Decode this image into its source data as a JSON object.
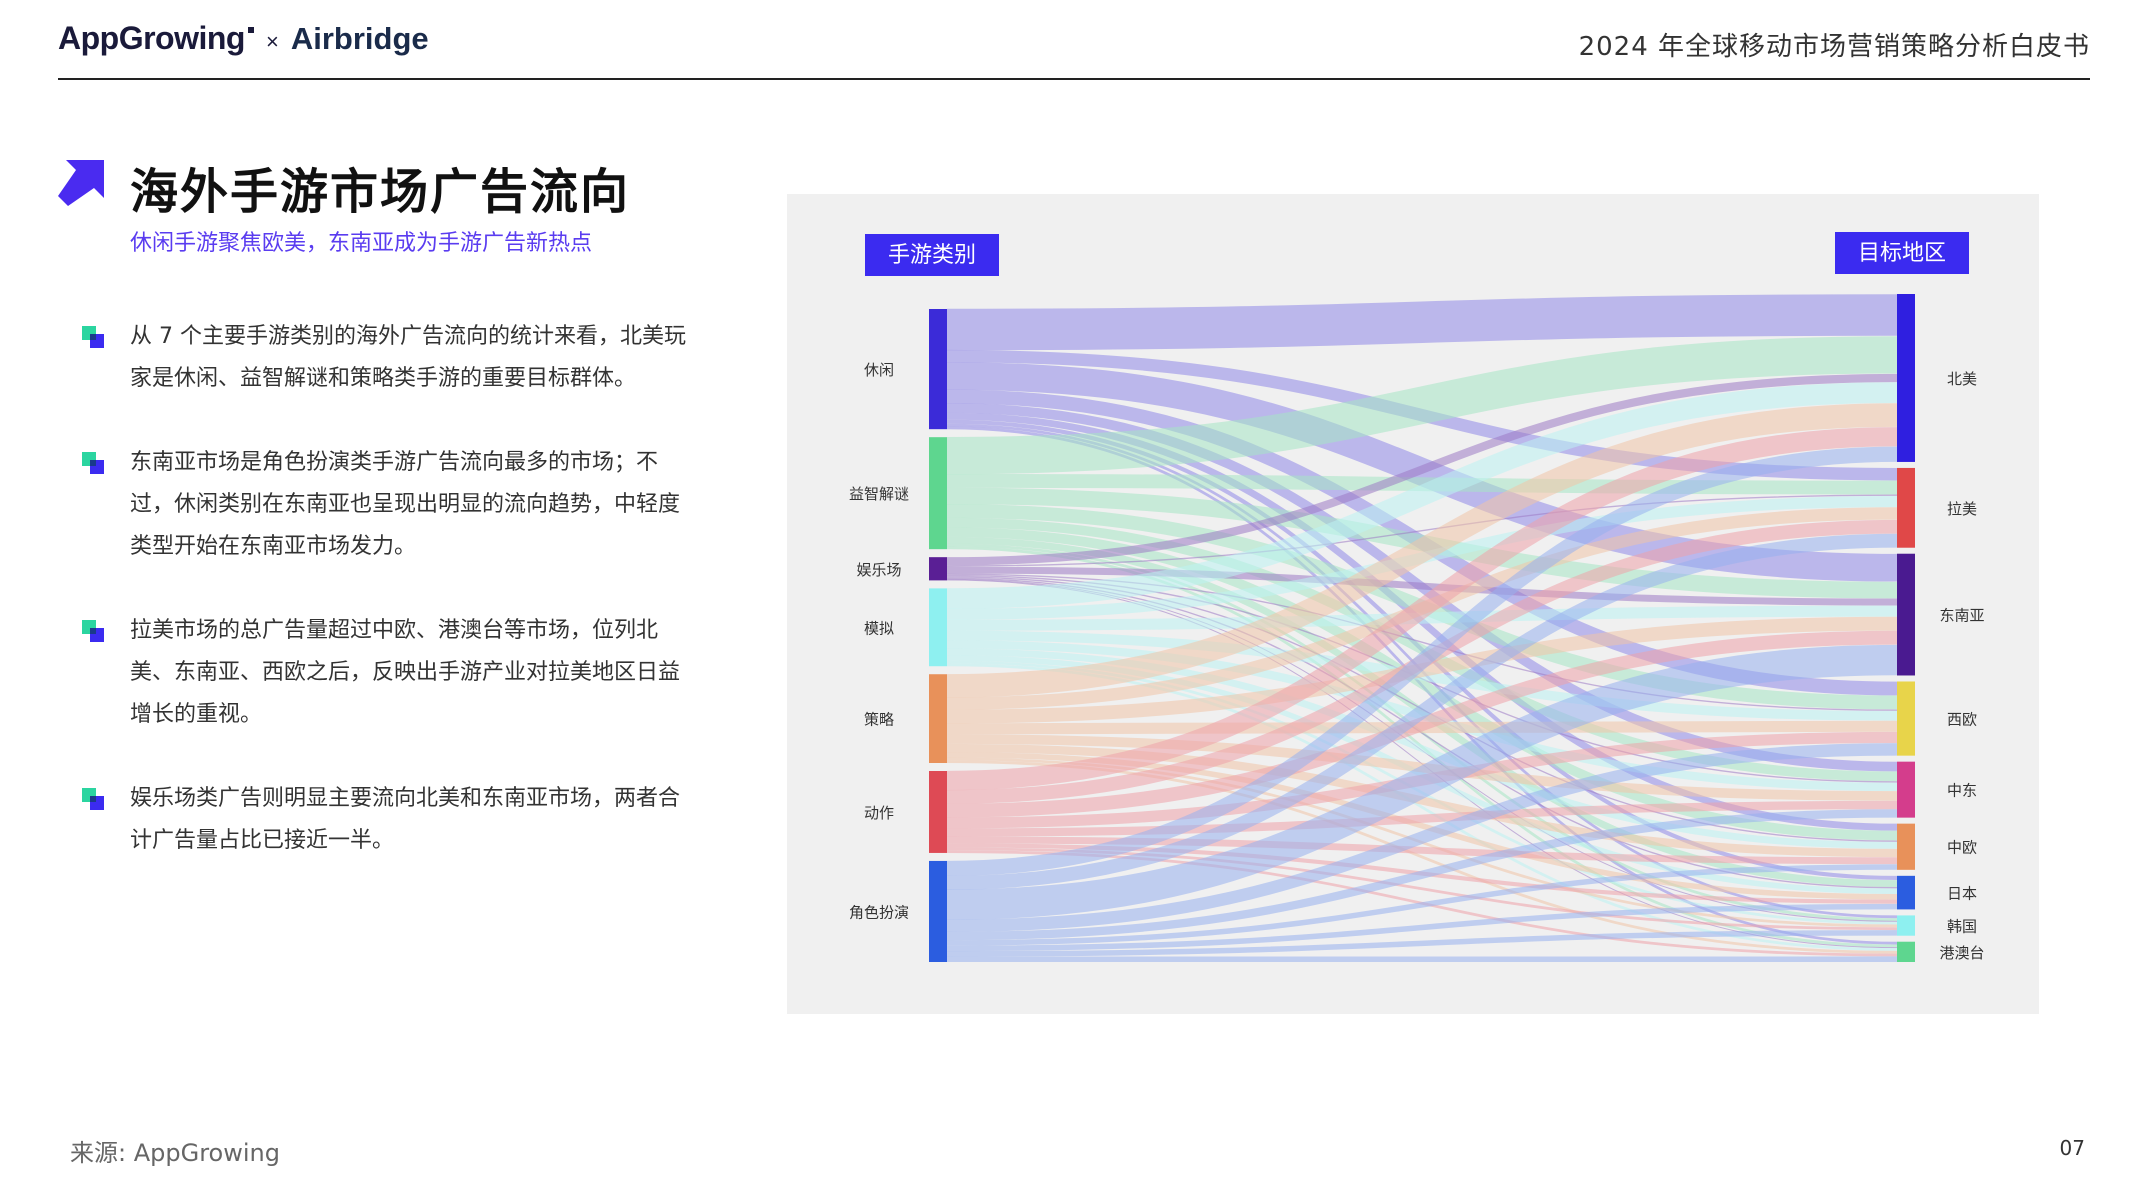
{
  "header": {
    "logo_left": "AppGrowing",
    "logo_separator": "×",
    "logo_right": "Airbridge",
    "doc_title": "2024 年全球移动市场营销策略分析白皮书"
  },
  "main": {
    "title": "海外手游市场广告流向",
    "subtitle": "休闲手游聚焦欧美，东南亚成为手游广告新热点",
    "bullets": [
      "从 7 个主要手游类别的海外广告流向的统计来看，北美玩家是休闲、益智解谜和策略类手游的重要目标群体。",
      "东南亚市场是角色扮演类手游广告流向最多的市场；不过，休闲类别在东南亚也呈现出明显的流向趋势，中轻度类型开始在东南亚市场发力。",
      "拉美市场的总广告量超过中欧、港澳台等市场，位列北美、东南亚、西欧之后，反映出手游产业对拉美地区日益增长的重视。",
      "娱乐场类广告则明显主要流向北美和东南亚市场，两者合计广告量占比已接近一半。"
    ]
  },
  "chart_data": {
    "type": "sankey",
    "left_header": "手游类别",
    "right_header": "目标地区",
    "sources": [
      {
        "name": "休闲",
        "color": "#3b2bd8",
        "link_color": "#8f88e8"
      },
      {
        "name": "益智解谜",
        "color": "#5ed68f",
        "link_color": "#a6e6c4"
      },
      {
        "name": "娱乐场",
        "color": "#5a1f95",
        "link_color": "#9d7ac4"
      },
      {
        "name": "模拟",
        "color": "#8ef0f0",
        "link_color": "#bcf2f2"
      },
      {
        "name": "策略",
        "color": "#e8915a",
        "link_color": "#f1c4a8"
      },
      {
        "name": "动作",
        "color": "#de4a55",
        "link_color": "#eea3a9"
      },
      {
        "name": "角色扮演",
        "color": "#2b5de0",
        "link_color": "#97b0ee"
      }
    ],
    "targets": [
      {
        "name": "北美",
        "color": "#2f1fe0"
      },
      {
        "name": "拉美",
        "color": "#e04848"
      },
      {
        "name": "东南亚",
        "color": "#4a1a90"
      },
      {
        "name": "西欧",
        "color": "#e8d44a"
      },
      {
        "name": "中东",
        "color": "#d43d8c"
      },
      {
        "name": "中欧",
        "color": "#e8915a"
      },
      {
        "name": "日本",
        "color": "#2b5de0"
      },
      {
        "name": "韩国",
        "color": "#8ef0f0"
      },
      {
        "name": "港澳台",
        "color": "#5ed68f"
      }
    ],
    "flows": [
      [
        30,
        9,
        20,
        10,
        7,
        5,
        3,
        2,
        2
      ],
      [
        27,
        10,
        12,
        10,
        7,
        7,
        5,
        2,
        2
      ],
      [
        6,
        1,
        5,
        1,
        1,
        1,
        1,
        0.5,
        0.5
      ],
      [
        15,
        8,
        8,
        7,
        6,
        5,
        4,
        2,
        2
      ],
      [
        17,
        9,
        10,
        8,
        7,
        6,
        4,
        2,
        2
      ],
      [
        14,
        10,
        10,
        8,
        6,
        5,
        3,
        2,
        2
      ],
      [
        11,
        10,
        22,
        9,
        6,
        4,
        4,
        4,
        4
      ]
    ]
  },
  "footer": {
    "source": "来源: AppGrowing",
    "page_number": "07"
  }
}
